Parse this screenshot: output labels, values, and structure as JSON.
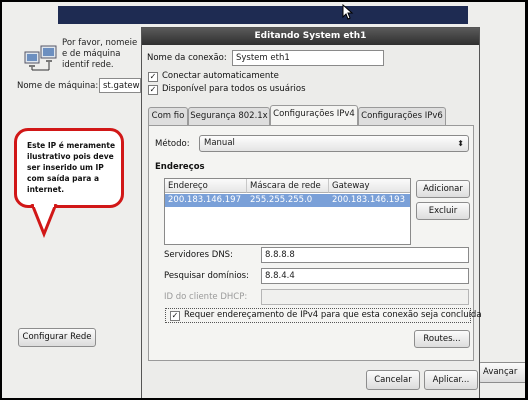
{
  "background": {
    "description": "Por favor, nomeie o seu computador. O nome de máquina identifica este computador na rede.",
    "description_visible": "Por favor, nomeie e de máquina identif rede.",
    "host_label": "Nome de máquina:",
    "host_value": "st.gatew",
    "configure_button": "Configurar Rede",
    "next_button": "Avançar"
  },
  "callout": {
    "text": "Este IP é meramente ilustrativo pois deve ser inserido um IP com saída para a internet."
  },
  "dialog": {
    "title": "Editando System eth1",
    "connection_name_label": "Nome da conexão:",
    "connection_name_value": "System eth1",
    "auto_connect_label": "Conectar automaticamente",
    "all_users_label": "Disponível para todos os usuários",
    "tabs": [
      "Com fio",
      "Segurança 802.1x",
      "Configurações IPv4",
      "Configurações IPv6"
    ],
    "ipv4": {
      "method_label": "Método:",
      "method_value": "Manual",
      "addresses_heading": "Endereços",
      "columns": [
        "Endereço",
        "Máscara de rede",
        "Gateway"
      ],
      "rows": [
        {
          "address": "200.183.146.197",
          "netmask": "255.255.255.0",
          "gateway": "200.183.146.193"
        }
      ],
      "add_button": "Adicionar",
      "delete_button": "Excluir",
      "dns_label": "Servidores DNS:",
      "dns_value": "8.8.8.8",
      "search_label": "Pesquisar domínios:",
      "search_value": "8.8.4.4",
      "dhcp_label": "ID do cliente DHCP:",
      "dhcp_value": "",
      "require_label": "Requer endereçamento de IPv4 para que esta conexão seja concluída",
      "routes_button": "Routes..."
    },
    "cancel_button": "Cancelar",
    "apply_button": "Aplicar..."
  },
  "colors": {
    "callout_border": "#d11717",
    "selection": "#7aa0d8",
    "titlebar": "#3a3a3a"
  }
}
